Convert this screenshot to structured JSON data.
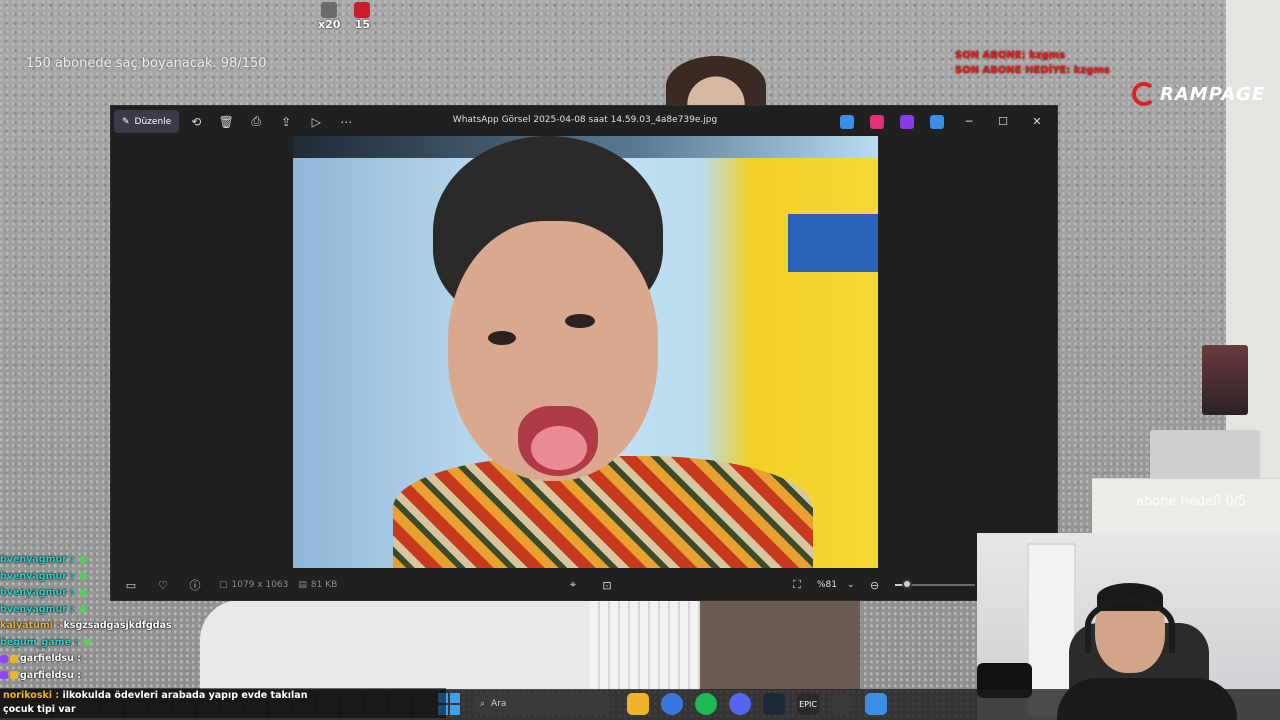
{
  "stream": {
    "goal_text": "150 abonede saç boyanacak. 98/150",
    "hud": [
      {
        "icon": "bit-icon",
        "count": "x20",
        "color": "#6a6a6a"
      },
      {
        "icon": "angry-emote-icon",
        "count": "15",
        "color": "#c8202a"
      }
    ],
    "son_abone": "SON ABONE: kzgms",
    "son_abone_hediye": "SON ABONE HEDİYE: kzgms",
    "brand": "RAMPAGE",
    "hedef_text": "abone hedefi 0/5"
  },
  "photos_window": {
    "title": "WhatsApp Görsel 2025-04-08 saat 14.59.03_4a8e739e.jpg",
    "edit_label": "Düzenle",
    "toolbar_icons": [
      "rotate-icon",
      "delete-icon",
      "print-icon",
      "share-icon",
      "slideshow-icon",
      "more-icon"
    ],
    "app_icons": [
      {
        "name": "photos-app-icon",
        "color": "#3a8ee6"
      },
      {
        "name": "clipchamp-icon",
        "color": "#e0307a"
      },
      {
        "name": "designer-icon",
        "color": "#8a3ae6"
      },
      {
        "name": "onedrive-icon",
        "color": "#3a8ee6"
      }
    ],
    "controls": {
      "minimize": "─",
      "maximize": "☐",
      "close": "✕"
    },
    "dimensions": "1079 x 1063",
    "file_size": "81 KB",
    "zoom": "%81",
    "zoom_level": 0.15
  },
  "chat": [
    {
      "user": "bvenyagmur :",
      "user_color": "#2fd0c8",
      "message": "",
      "emote": true
    },
    {
      "user": "bvenyagmur :",
      "user_color": "#2fd0c8",
      "message": "",
      "emote": true
    },
    {
      "user": "bvenyagmur :",
      "user_color": "#2fd0c8",
      "message": "",
      "emote": true
    },
    {
      "user": "bvenyagmur :",
      "user_color": "#2fd0c8",
      "message": "",
      "emote": true
    },
    {
      "user": "kalyatumi :",
      "user_color": "#e6b14a",
      "message": "ksgzsadgasjkdfgdas",
      "emote": false
    },
    {
      "user": "begum_game :",
      "user_color": "#2fd0c8",
      "message": "",
      "emote": true
    },
    {
      "user": "garfieldsu :",
      "user_color": "#ffffff",
      "message": "",
      "emote": false
    },
    {
      "user": "garfieldsu :",
      "user_color": "#ffffff",
      "message": "",
      "emote": false
    }
  ],
  "chat_bottom": {
    "user": "norikoski :",
    "message": "ilkokulda ödevleri arabada yapıp evde takılan",
    "message2": "çocuk tipi var"
  },
  "taskbar": {
    "search_placeholder": "Ara",
    "apps": [
      {
        "name": "file-explorer-icon",
        "color": "#f0b429",
        "label": ""
      },
      {
        "name": "chrome-icon",
        "color": "#3a78e0",
        "label": ""
      },
      {
        "name": "spotify-icon",
        "color": "#1db954",
        "label": ""
      },
      {
        "name": "discord-icon",
        "color": "#5865f2",
        "label": ""
      },
      {
        "name": "steam-icon",
        "color": "#1b2838",
        "label": ""
      },
      {
        "name": "epic-games-icon",
        "color": "#2a2a2a",
        "label": "EPIC"
      },
      {
        "name": "obs-icon",
        "color": "#3a3a3a",
        "label": ""
      },
      {
        "name": "photos-taskbar-icon",
        "color": "#3a8ee6",
        "label": ""
      }
    ]
  }
}
